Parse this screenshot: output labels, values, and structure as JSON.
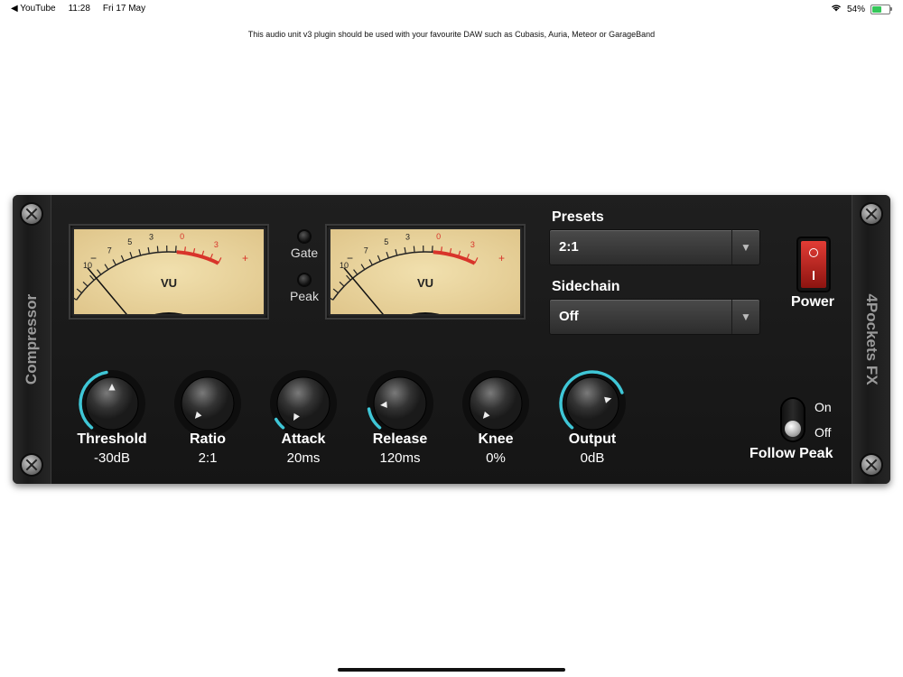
{
  "status_bar": {
    "back_app": "◀ YouTube",
    "time": "11:28",
    "date": "Fri 17 May",
    "battery_percent": "54%",
    "battery_level": 0.54
  },
  "notice": "This audio unit v3 plugin should be used with your favourite DAW such as Cubasis, Auria, Meteor or GarageBand",
  "plugin": {
    "left_label": "Compressor",
    "right_label": "4Pockets FX",
    "vu_meters": [
      {
        "label": "VU",
        "scale": [
          "20",
          "10",
          "7",
          "5",
          "3",
          "0",
          "3"
        ],
        "minus": "−",
        "plus": "+"
      },
      {
        "label": "VU",
        "scale": [
          "20",
          "10",
          "7",
          "5",
          "3",
          "0",
          "3"
        ],
        "minus": "−",
        "plus": "+"
      }
    ],
    "indicators": {
      "gate": "Gate",
      "peak": "Peak"
    },
    "presets": {
      "label": "Presets",
      "value": "2:1"
    },
    "sidechain": {
      "label": "Sidechain",
      "value": "Off"
    },
    "power": {
      "label": "Power",
      "state": "on"
    },
    "knobs": [
      {
        "name": "Threshold",
        "value": "-30dB"
      },
      {
        "name": "Ratio",
        "value": "2:1"
      },
      {
        "name": "Attack",
        "value": "20ms"
      },
      {
        "name": "Release",
        "value": "120ms"
      },
      {
        "name": "Knee",
        "value": "0%"
      },
      {
        "name": "Output",
        "value": "0dB"
      }
    ],
    "follow_peak": {
      "label": "Follow Peak",
      "on": "On",
      "off": "Off",
      "state": "off"
    }
  },
  "colors": {
    "accent_arc": "#3fc6d6",
    "power_red": "#d8302a",
    "vu_face": "#ead39a"
  }
}
